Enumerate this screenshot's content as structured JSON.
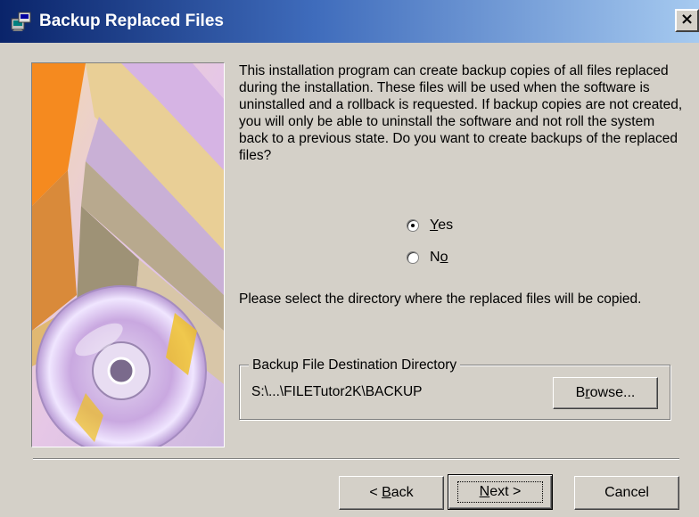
{
  "window": {
    "title": "Backup Replaced Files",
    "close_glyph": "×",
    "title_icon": "setup-wizard-icon",
    "title_gradient": [
      "#0a246a",
      "#a6caf0"
    ]
  },
  "side_image": {
    "icon": "wizard-art-cd-illustration"
  },
  "intro": {
    "text": "This installation program can create backup copies of all files replaced during the installation. These files will be used when the software is uninstalled and a rollback is requested.  If backup copies are not created, you will only be able to uninstall the software and not roll the system back to a previous state. Do you want to create backups of the replaced files?"
  },
  "backup_choice": {
    "selected": "Yes",
    "yes": {
      "prefix": "",
      "mnemonic": "Y",
      "rest": "es"
    },
    "no": {
      "prefix": "N",
      "mnemonic": "o",
      "rest": ""
    }
  },
  "directory": {
    "prompt": "Please select the directory where the replaced  files will be copied.",
    "group_label": "Backup File Destination Directory",
    "path": "S:\\...\\FILETutor2K\\BACKUP",
    "browse": {
      "prefix": "B",
      "mnemonic": "r",
      "rest": "owse..."
    }
  },
  "footer": {
    "back": {
      "prefix": "< ",
      "mnemonic": "B",
      "rest": "ack"
    },
    "next": {
      "prefix": "",
      "mnemonic": "N",
      "rest": "ext >"
    },
    "cancel": "Cancel"
  }
}
